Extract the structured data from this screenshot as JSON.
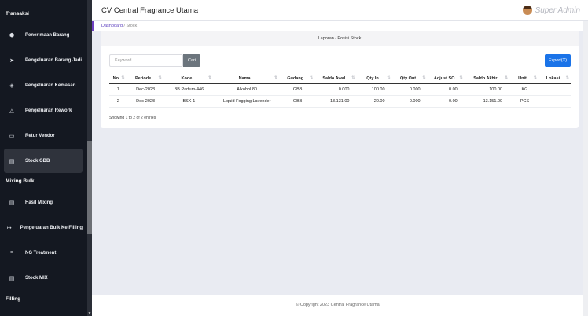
{
  "sidebar": {
    "sections": [
      {
        "label": "Transaksi"
      },
      {
        "label": "Mixing Bulk"
      },
      {
        "label": "Filling"
      }
    ],
    "items": [
      {
        "label": "Penerimaan Barang",
        "icon": "box-icon"
      },
      {
        "label": "Pengeluaran Barang Jadi",
        "icon": "send-icon"
      },
      {
        "label": "Pengeluaran Kemasan",
        "icon": "cube-icon"
      },
      {
        "label": "Pengeluaran Rework",
        "icon": "recycle-icon"
      },
      {
        "label": "Retur Vendor",
        "icon": "return-icon"
      },
      {
        "label": "Stock GBB",
        "icon": "clipboard-icon"
      },
      {
        "label": "Hasil Mixing",
        "icon": "list-icon"
      },
      {
        "label": "Pengeluaran Bulk Ke Filling",
        "icon": "transfer-icon"
      },
      {
        "label": "NG Treatment",
        "icon": "treatment-icon"
      },
      {
        "label": "Stock MIX",
        "icon": "clipboard-icon"
      }
    ]
  },
  "header": {
    "title": "CV Central Fragrance Utama",
    "user": "Super Admin"
  },
  "breadcrumb": {
    "home": "Dashboard",
    "separator": "/",
    "current": "Stock"
  },
  "card": {
    "title": "Laporan / Posisi Stock"
  },
  "search": {
    "placeholder": "Keyword",
    "button": "Cari"
  },
  "export": {
    "label": "Export(X)"
  },
  "table": {
    "columns": [
      "No",
      "Periode",
      "Kode",
      "Nama",
      "Gudang",
      "Saldo Awal",
      "Qty In",
      "Qty Out",
      "Adjust SO",
      "Saldo Akhir",
      "Unit",
      "Lokasi"
    ],
    "rows": [
      [
        "1",
        "Dec-2023",
        "BB Parfum-446",
        "Alkohol 80",
        "GBB",
        "0.000",
        "100.00",
        "0.000",
        "0.00",
        "100.00",
        "KG",
        ""
      ],
      [
        "2",
        "Dec-2023",
        "BSK-1",
        "Liquid Fogging Lavender",
        "GBB",
        "13.131.00",
        "20.00",
        "0.000",
        "0.00",
        "13.151.00",
        "PCS",
        ""
      ]
    ],
    "info": "Showing 1 to 2 of 2 entries"
  },
  "footer": {
    "copyright": "© Copyright 2023 Central Fragrance Utama"
  },
  "colors": {
    "sidebar_bg": "#141821",
    "accent": "#6f42c1",
    "primary_button": "#1a73e8",
    "secondary_button": "#6c757d"
  }
}
